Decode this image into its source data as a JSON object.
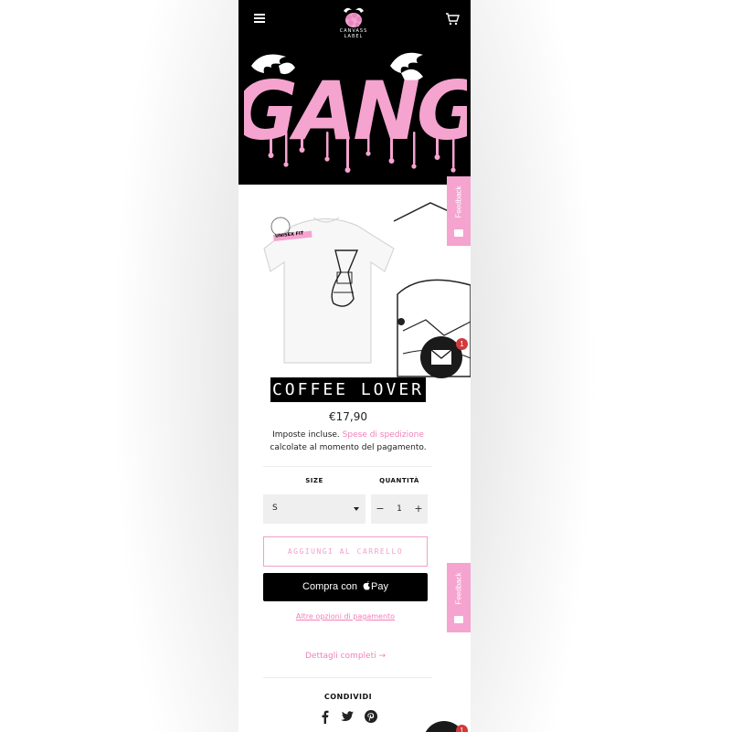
{
  "brand": {
    "logo_line1": "CANVASS",
    "logo_line2": "LABEL"
  },
  "header": {
    "menu_icon": "hamburger-icon",
    "cart_icon": "cart-icon",
    "banner_text": "GANG"
  },
  "feedback": {
    "label": "Feedback",
    "icon": "message-icon"
  },
  "chat": {
    "badge_count": "1",
    "icon": "envelope-icon"
  },
  "product": {
    "image_badge": "UNISEX FIT",
    "title": "COFFEE LOVER",
    "price": "€17,90",
    "tax_text": "Imposte incluse.",
    "shipping_link": "Spese di spedizione",
    "tax_text_2": "calcolate al momento del pagamento."
  },
  "options": {
    "size_label": "SIZE",
    "size_value": "S",
    "qty_label": "QUANTITÀ",
    "qty_minus": "−",
    "qty_value": "1",
    "qty_plus": "+"
  },
  "actions": {
    "add_to_cart": "AGGIUNGI AL CARRELLO",
    "apple_pay_prefix": "Compra con",
    "apple_pay_brand": "Pay",
    "more_options": "Altre opzioni di pagamento",
    "full_details": "Dettagli completi →"
  },
  "share": {
    "label": "CONDIVIDI",
    "icons": [
      "facebook-icon",
      "twitter-icon",
      "pinterest-icon"
    ]
  },
  "colors": {
    "accent_pink": "#f17fba",
    "header_bg": "#000000",
    "badge_red": "#d2393a"
  }
}
